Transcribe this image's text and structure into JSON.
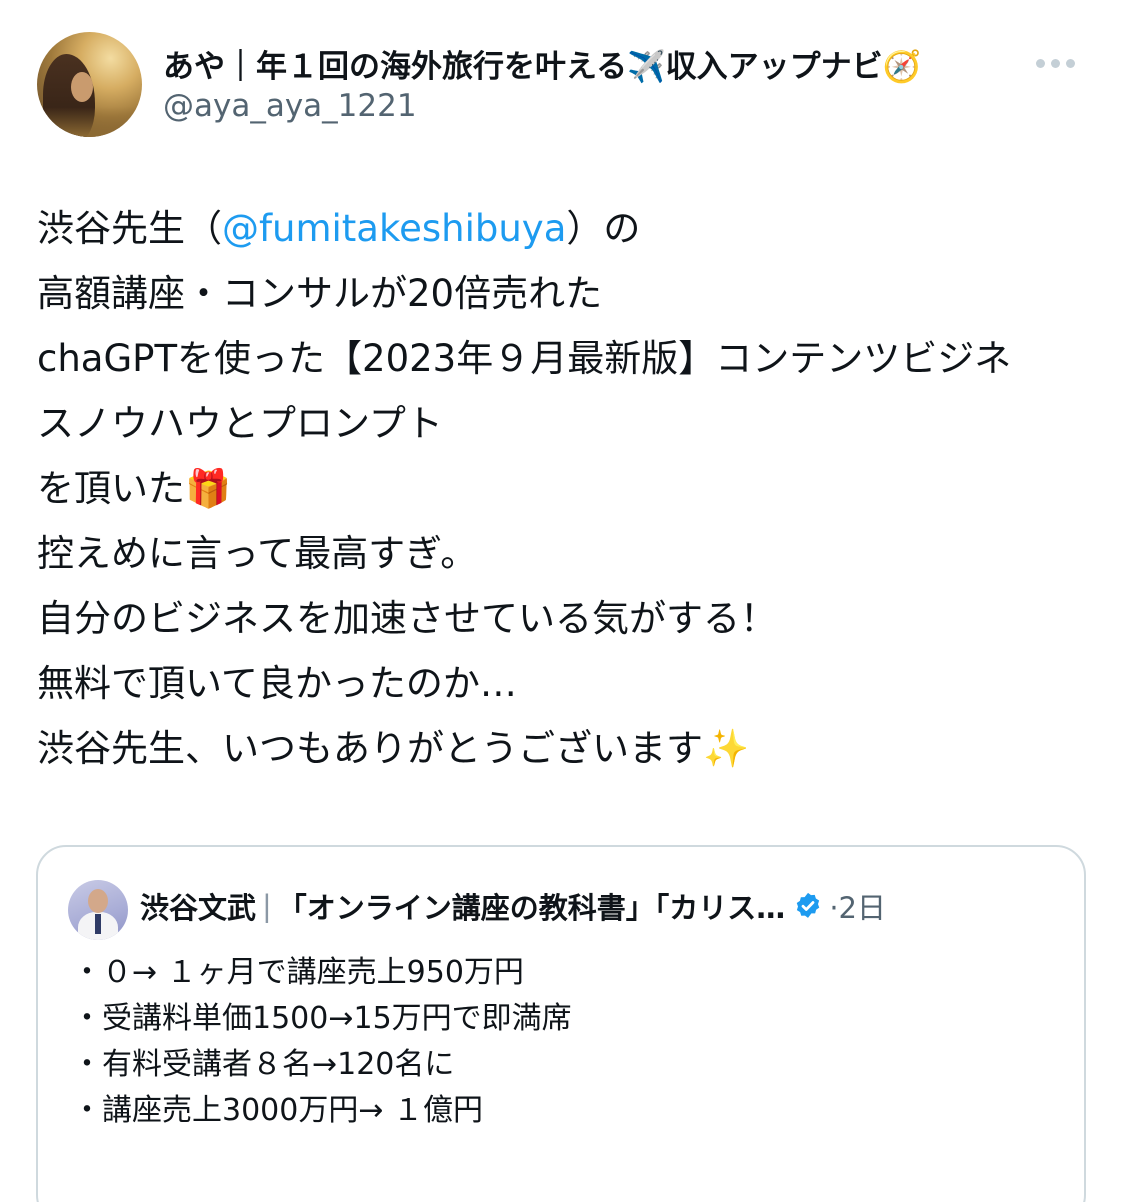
{
  "author": {
    "display_name": "あや｜年１回の海外旅行を叶える✈️収入アップナビ🧭",
    "handle": "@aya_aya_1221"
  },
  "tweet": {
    "line1_pre": "渋谷先生（",
    "mention": "@fumitakeshibuya",
    "line1_post": "）の",
    "lines": [
      "高額講座・コンサルが20倍売れた",
      "chaGPTを使った【2023年９月最新版】コンテンツビジネ",
      "スノウハウとプロンプト",
      "を頂いた🎁",
      "控えめに言って最高すぎ。",
      "自分のビジネスを加速させている気がする！",
      "無料で頂いて良かったのか…",
      "渋谷先生、いつもありがとうございます✨"
    ]
  },
  "quote": {
    "name": "渋谷文武",
    "separator": "|",
    "title": "「オンライン講座の教科書」「カリス…",
    "time": "·2日",
    "lines": [
      "・０→ １ヶ月で講座売上950万円",
      "・受講料単価1500→15万円で即満席",
      "・有料受講者８名→120名に",
      "・講座売上3000万円→ １億円"
    ]
  },
  "colors": {
    "mention": "#1d9bf0",
    "verified": "#1d9bf0",
    "secondary_text": "#536471"
  }
}
